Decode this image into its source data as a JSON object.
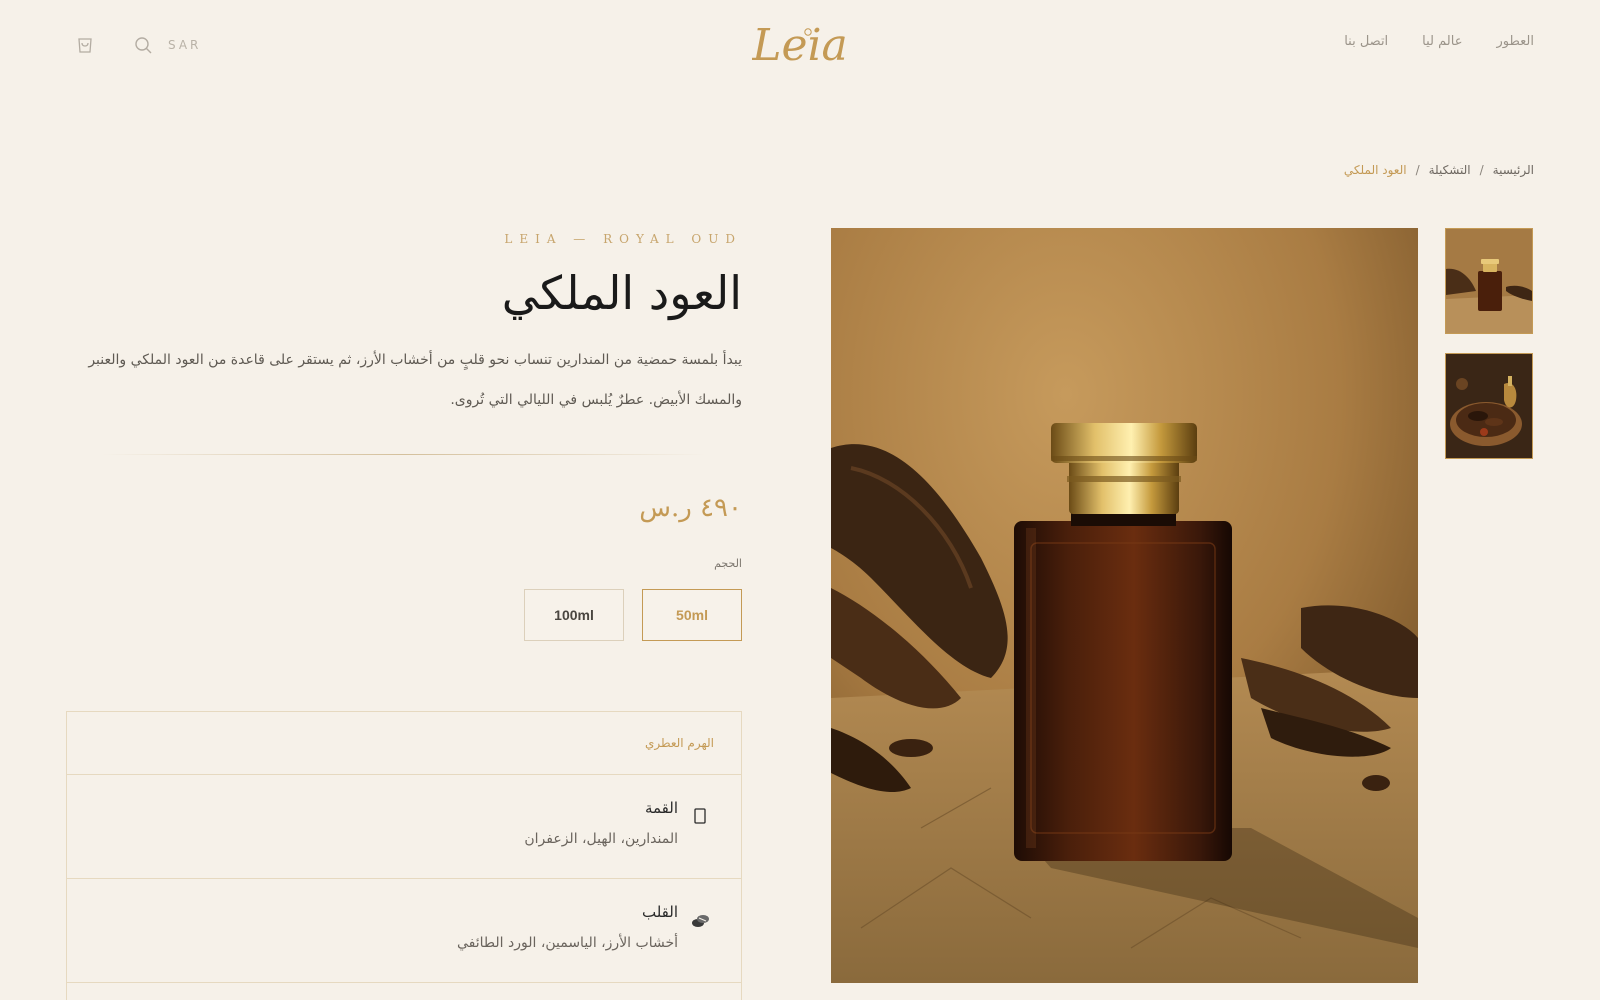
{
  "header": {
    "currency": "SAR",
    "logo_text": "Leia",
    "nav": [
      "العطور",
      "عالم ليا",
      "اتصل بنا"
    ],
    "icons": [
      "cart-icon",
      "search-icon"
    ]
  },
  "breadcrumb": {
    "items": [
      "الرئيسية",
      "التشكيلة",
      "العود الملكي"
    ],
    "separator": "/"
  },
  "product": {
    "collection": "LEIA — ROYAL OUD",
    "title": "العود الملكي",
    "description": "يبدأ بلمسة حمضية من المندارين تنساب نحو قلبٍ من أخشاب الأرز، ثم يستقر على قاعدة من العود الملكي والعنبر والمسك الأبيض. عطرٌ يُلبس في الليالي التي تُروى.",
    "price": "٤٩٠ ر.س",
    "size_label": "الحجم",
    "sizes": [
      "50ml",
      "100ml"
    ],
    "selected_size": "50ml",
    "images": {
      "main": "perfume-bottle-photo",
      "thumbnails": [
        "perfume-bottle-thumbnail",
        "oud-bowl-thumbnail"
      ]
    }
  },
  "pyramid": {
    "title": "الهرم العطري",
    "notes": [
      {
        "name": "القمة",
        "ingredients": "المندارين، الهيل، الزعفران",
        "icon": "citrus-icon"
      },
      {
        "name": "القلب",
        "ingredients": "أخشاب الأرز، الياسمين، الورد الطائفي",
        "icon": "wood-icon"
      }
    ]
  },
  "colors": {
    "background": "#f6f1e9",
    "accent_gold": "#c49a55",
    "border": "#e6d9c0",
    "text_dark": "#1a1a1a"
  }
}
